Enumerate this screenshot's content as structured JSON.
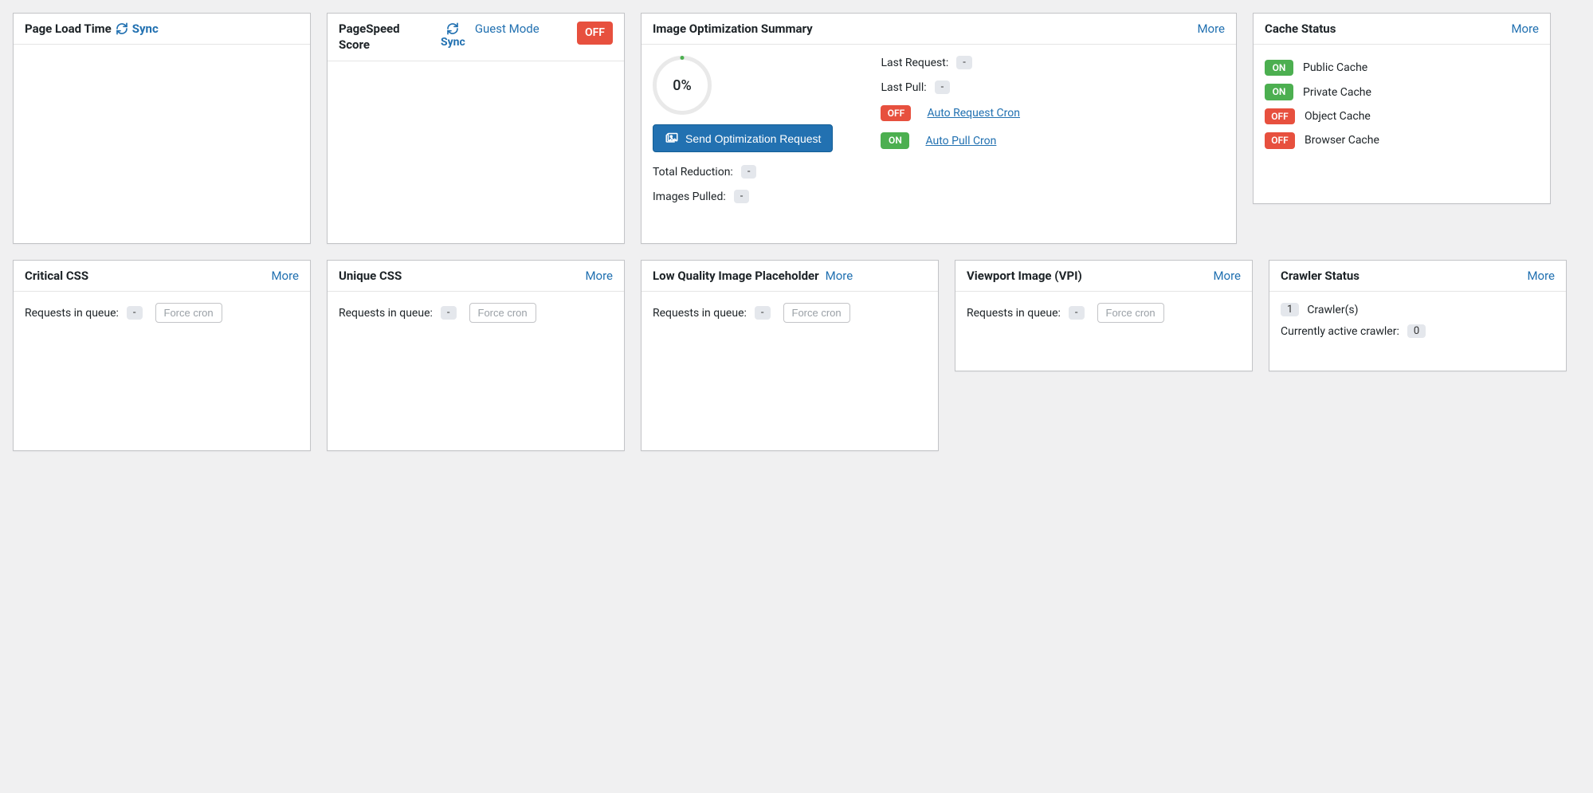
{
  "labels": {
    "more": "More",
    "sync": "Sync",
    "on": "ON",
    "off": "OFF",
    "force_cron": "Force cron",
    "requests_in_queue": "Requests in queue:"
  },
  "page_load_time": {
    "title": "Page Load Time"
  },
  "pagespeed": {
    "title": "PageSpeed Score",
    "guest_mode": "Guest Mode",
    "status": "OFF"
  },
  "image_opt": {
    "title": "Image Optimization Summary",
    "gauge": "0%",
    "send_btn": "Send Optimization Request",
    "total_reduction_label": "Total Reduction:",
    "total_reduction_value": "-",
    "images_pulled_label": "Images Pulled:",
    "images_pulled_value": "-",
    "last_request_label": "Last Request:",
    "last_request_value": "-",
    "last_pull_label": "Last Pull:",
    "last_pull_value": "-",
    "auto_request_cron": {
      "status": "OFF",
      "label": "Auto Request Cron"
    },
    "auto_pull_cron": {
      "status": "ON",
      "label": "Auto Pull Cron"
    }
  },
  "cache_status": {
    "title": "Cache Status",
    "items": [
      {
        "status": "ON",
        "label": "Public Cache"
      },
      {
        "status": "ON",
        "label": "Private Cache"
      },
      {
        "status": "OFF",
        "label": "Object Cache"
      },
      {
        "status": "OFF",
        "label": "Browser Cache"
      }
    ]
  },
  "critical_css": {
    "title": "Critical CSS",
    "queue": "-"
  },
  "unique_css": {
    "title": "Unique CSS",
    "queue": "-"
  },
  "lqip": {
    "title": "Low Quality Image Placeholder",
    "queue": "-"
  },
  "vpi": {
    "title": "Viewport Image (VPI)",
    "queue": "-"
  },
  "crawler": {
    "title": "Crawler Status",
    "count": "1",
    "count_label": "Crawler(s)",
    "active_label": "Currently active crawler:",
    "active_value": "0"
  }
}
